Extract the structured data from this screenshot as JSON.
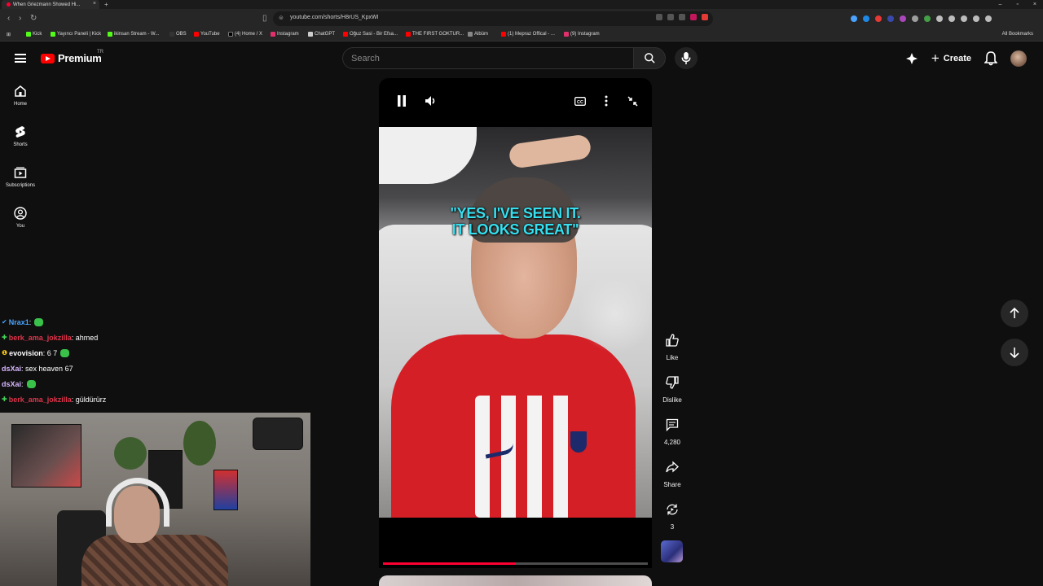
{
  "browser": {
    "tab_title": "When Griezmann Showed Hi...",
    "url": "youtube.com/shorts/H8rUS_KpxWI",
    "bookmarks": [
      {
        "label": "Kick",
        "color": "#53fc18"
      },
      {
        "label": "Yayıncı Paneli | Kick",
        "color": "#53fc18"
      },
      {
        "label": "ikinsan Stream - W...",
        "color": "#53fc18"
      },
      {
        "label": "OBS",
        "color": "#333333"
      },
      {
        "label": "YouTube",
        "color": "#ff0000"
      },
      {
        "label": "(4) Home / X",
        "color": "#000000"
      },
      {
        "label": "Instagram",
        "color": "#e1306c"
      },
      {
        "label": "ChatGPT",
        "color": "#cccccc"
      },
      {
        "label": "Oğuz Sasi - Bir Efsa...",
        "color": "#ff0000"
      },
      {
        "label": "THE FIRST GOKTUR...",
        "color": "#ff0000"
      },
      {
        "label": "Albüm",
        "color": "#888888"
      },
      {
        "label": "(1) Mepraz Offical - ...",
        "color": "#ff0000"
      },
      {
        "label": "(9) Instagram",
        "color": "#e1306c"
      }
    ],
    "all_bookmarks": "All Bookmarks"
  },
  "header": {
    "logo_text": "Premium",
    "country": "TR",
    "search_placeholder": "Search",
    "create_label": "Create"
  },
  "rail": [
    {
      "label": "Home",
      "icon": "home-icon"
    },
    {
      "label": "Shorts",
      "icon": "shorts-icon"
    },
    {
      "label": "Subscriptions",
      "icon": "subscriptions-icon"
    },
    {
      "label": "You",
      "icon": "you-icon"
    }
  ],
  "chat": [
    {
      "user": "Nrax1",
      "user_color": "#4aa3ff",
      "badge": "✔",
      "text": "",
      "emote": true
    },
    {
      "user": "berk_ama_jokzilla",
      "user_color": "#e0344a",
      "badge": "✚",
      "text": "ahmed",
      "emote": false
    },
    {
      "user": "evovision",
      "user_color": "#ffffff",
      "badge": "❶",
      "text": "6 7",
      "emote": true
    },
    {
      "user": "dsXai",
      "user_color": "#d8b6ff",
      "badge": "",
      "text": "sex heaven 67",
      "emote": false
    },
    {
      "user": "dsXai",
      "user_color": "#d8b6ff",
      "badge": "",
      "text": "",
      "emote": true
    },
    {
      "user": "berk_ama_jokzilla",
      "user_color": "#e0344a",
      "badge": "✚",
      "text": "güldürürz",
      "emote": false
    }
  ],
  "video": {
    "caption_line1": "\"YES, I'VE SEEN IT.",
    "caption_line2": "IT LOOKS GREAT\"",
    "progress": 0.5,
    "progress_color": "#ff0033"
  },
  "actions": {
    "like": "Like",
    "dislike": "Dislike",
    "comments": "4,280",
    "share": "Share",
    "remix": "3"
  }
}
